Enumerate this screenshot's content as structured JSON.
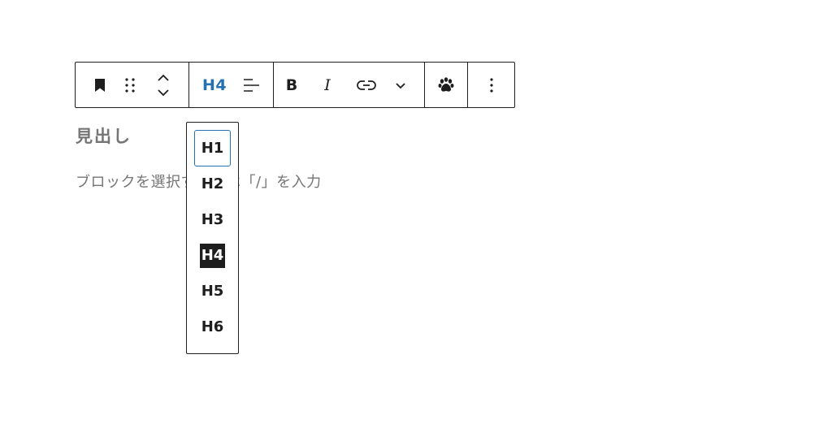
{
  "toolbar": {
    "heading_level": "H4",
    "bold_label": "B",
    "italic_label": "I"
  },
  "block": {
    "title": "見出し",
    "placeholder": "ブロックを選択するには「/」を入力"
  },
  "heading_dropdown": {
    "options": [
      "H1",
      "H2",
      "H3",
      "H4",
      "H5",
      "H6"
    ],
    "focused": "H1",
    "selected": "H4"
  },
  "colors": {
    "accent": "#2271b1",
    "text": "#1e1e1e",
    "muted": "#757575"
  }
}
